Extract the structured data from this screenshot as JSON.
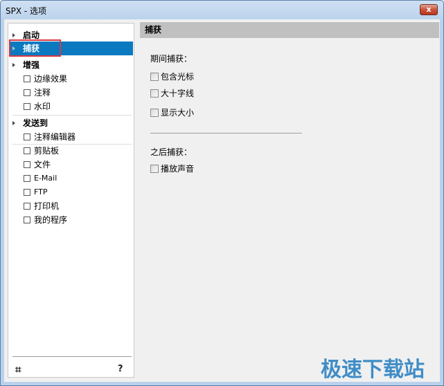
{
  "window": {
    "title": "SPX - 选项",
    "close_label": "x"
  },
  "sidebar": {
    "groups": [
      {
        "label": "启动",
        "items": []
      },
      {
        "label": "捕获",
        "selected": true,
        "items": []
      },
      {
        "label": "增强",
        "items": [
          "边缘效果",
          "注释",
          "水印"
        ]
      },
      {
        "label": "发送到",
        "items": [
          "注释编辑器",
          "剪贴板",
          "文件",
          "E-Mail",
          "FTP",
          "打印机",
          "我的程序"
        ]
      }
    ],
    "crop_icon": "crop-icon",
    "help_label": "?"
  },
  "panel": {
    "title": "捕获",
    "during_label": "期间捕获：",
    "during_options": [
      {
        "label": "包含光标",
        "checked": false
      },
      {
        "label": "大十字线",
        "checked": false
      },
      {
        "label": "显示大小",
        "checked": false
      }
    ],
    "after_label": "之后捕获：",
    "after_options": [
      {
        "label": "播放声音",
        "checked": false
      }
    ]
  },
  "watermark": "极速下载站",
  "colors": {
    "selection": "#0a79c0",
    "highlight_box": "#d9383e",
    "header": "#c0c0c0"
  }
}
